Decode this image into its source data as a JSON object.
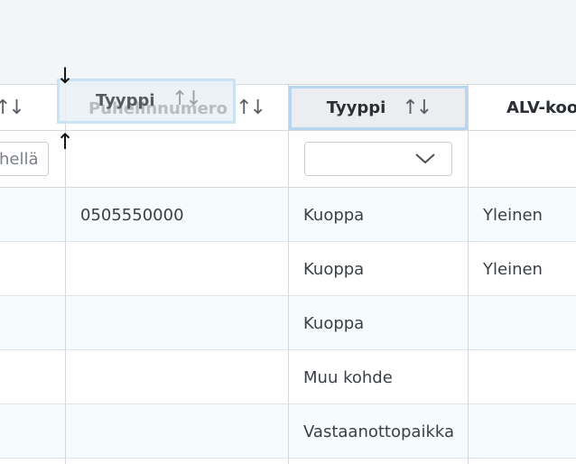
{
  "grid": {
    "left_partial": {
      "sort_icon": "↑↓",
      "filter_text": "hellä"
    },
    "columns": [
      {
        "id": "puhelinnumero",
        "header": "Puhelinnumero",
        "sort_icon": "↑↓"
      },
      {
        "id": "tyyppi",
        "header": "Tyyppi",
        "sort_icon": "↑↓"
      },
      {
        "id": "alv",
        "header": "ALV-koo"
      }
    ],
    "drag_ghost": {
      "label": "Tyyppi",
      "sort_icon": "↑↓"
    },
    "drop_marker": {
      "top_arrow": "↓",
      "bottom_arrow": "↑"
    },
    "filter_select_value": "",
    "rows": [
      {
        "puhelinnumero": "0505550000",
        "tyyppi": "Kuoppa",
        "alv": "Yleinen"
      },
      {
        "puhelinnumero": "",
        "tyyppi": "Kuoppa",
        "alv": "Yleinen"
      },
      {
        "puhelinnumero": "",
        "tyyppi": "Kuoppa",
        "alv": ""
      },
      {
        "puhelinnumero": "",
        "tyyppi": "Muu kohde",
        "alv": ""
      },
      {
        "puhelinnumero": "",
        "tyyppi": "Vastaanottopaikka",
        "alv": ""
      }
    ]
  },
  "colors": {
    "header_border": "#d5d8dc",
    "alt_row": "#f6fbfe",
    "active_border": "#b7d7f0"
  }
}
